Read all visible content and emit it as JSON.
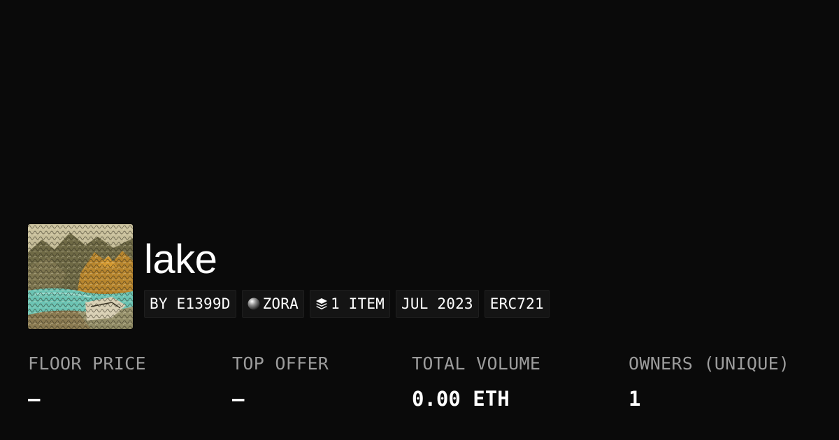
{
  "collection": {
    "name": "lake",
    "image_alt": "lake artwork thumbnail"
  },
  "tags": [
    {
      "label": "BY E1399D",
      "icon": null
    },
    {
      "label": "ZORA",
      "icon": "zora-orb-icon"
    },
    {
      "label": "1 ITEM",
      "icon": "layers-icon"
    },
    {
      "label": "JUL 2023",
      "icon": null
    },
    {
      "label": "ERC721",
      "icon": null
    }
  ],
  "stats": [
    {
      "label": "FLOOR PRICE",
      "value": "–"
    },
    {
      "label": "TOP OFFER",
      "value": "–"
    },
    {
      "label": "TOTAL VOLUME",
      "value": "0.00 ETH"
    },
    {
      "label": "OWNERS (UNIQUE)",
      "value": "1"
    }
  ],
  "colors": {
    "background": "#0a0a0a",
    "tag_background": "#141414",
    "label_gray": "#9c9c9c",
    "text": "#ffffff"
  }
}
